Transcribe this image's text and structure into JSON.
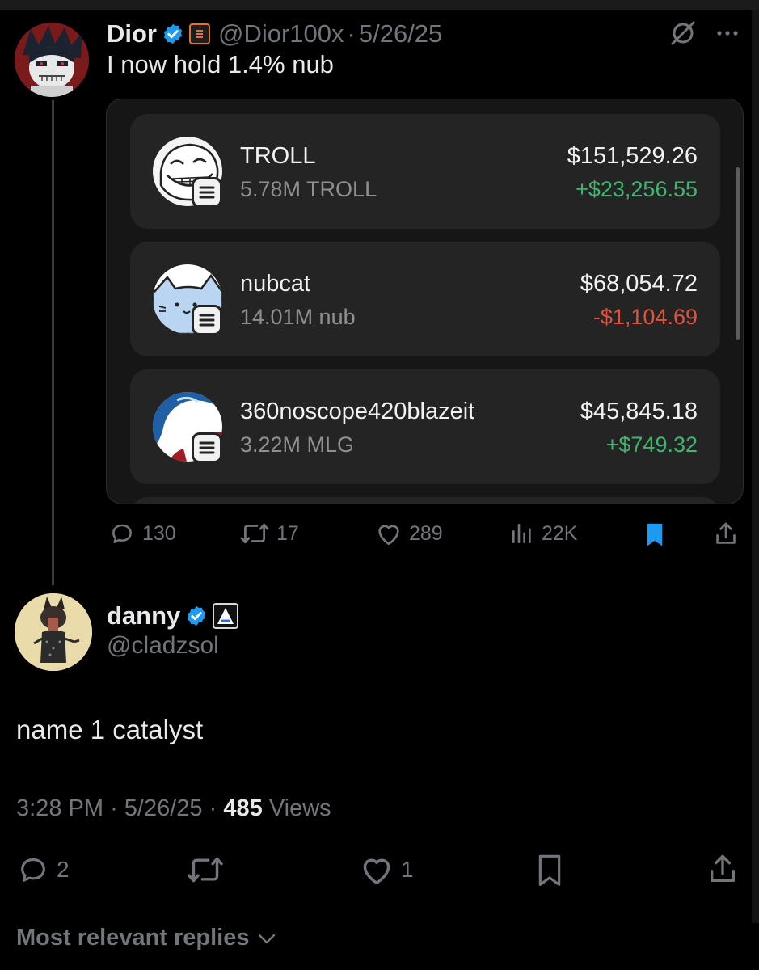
{
  "colors": {
    "background": "#000000",
    "verified": "#1d9bf0",
    "bookmark_active": "#1d9bf0",
    "positive": "#3fb66f",
    "negative": "#e0533b",
    "affiliate_badge": "#e27333"
  },
  "original_post": {
    "author_name": "Dior",
    "handle": "@Dior100x",
    "separator": "·",
    "date": "5/26/25",
    "text": "I now hold 1.4% nub",
    "wallet": {
      "tokens": [
        {
          "name": "TROLL",
          "amount": "5.78M TROLL",
          "value": "$151,529.26",
          "change": "+$23,256.55",
          "direction": "up",
          "icon": "troll-face-icon"
        },
        {
          "name": "nubcat",
          "amount": "14.01M nub",
          "value": "$68,054.72",
          "change": "-$1,104.69",
          "direction": "down",
          "icon": "nubcat-icon"
        },
        {
          "name": "360noscope420blazeit",
          "amount": "3.22M MLG",
          "value": "$45,845.18",
          "change": "+$749.32",
          "direction": "up",
          "icon": "mlg-icon"
        }
      ]
    },
    "stats": {
      "replies": "130",
      "reposts": "17",
      "likes": "289",
      "views": "22K"
    }
  },
  "reply_post": {
    "author_name": "danny",
    "handle": "@cladzsol",
    "text": "name 1 catalyst",
    "time": "3:28 PM",
    "separator": "·",
    "date": "5/26/25",
    "views_count": "485",
    "views_label": "Views",
    "stats": {
      "replies": "2",
      "likes": "1"
    }
  },
  "replies_sort": {
    "label": "Most relevant replies"
  }
}
